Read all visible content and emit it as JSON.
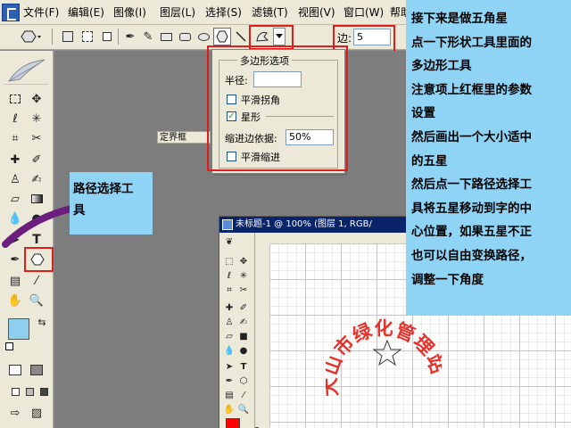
{
  "menu": {
    "items": [
      "文件(F)",
      "编辑(E)",
      "图像(I)",
      "图层(L)",
      "选择(S)",
      "滤镜(T)",
      "视图(V)",
      "窗口(W)",
      "帮助"
    ]
  },
  "options_bar": {
    "sides_label": "边:",
    "sides_value": "5"
  },
  "polygon_options": {
    "title": "多边形选项",
    "radius_label": "半径:",
    "radius_value": "",
    "smooth_corners_label": "平滑拐角",
    "smooth_corners_checked": false,
    "star_label": "星形",
    "star_checked": true,
    "indent_label": "缩进边依据:",
    "indent_value": "50%",
    "smooth_indents_label": "平滑缩进",
    "smooth_indents_checked": false
  },
  "callout": {
    "lines": [
      "路径选择工",
      "具"
    ]
  },
  "instructions": {
    "lines": [
      "接下来是做五角星",
      "点一下形状工具里面的",
      "多边形工具",
      "注意项上红框里的参数",
      "设置",
      "然后画出一个大小适中",
      "的五星",
      "然后点一下路径选择工",
      "具将五星移动到字的中",
      "心位置，如果五星不正",
      "也可以自由变换路径，",
      "调整一下角度"
    ]
  },
  "document": {
    "title": "未标题-1 @ 100% (图层 1, RGB/",
    "ruler_text": "定界框",
    "seal_text": "大山市绿化管理站"
  },
  "colors": {
    "highlight": "#e21b1b",
    "instruction_bg": "#8fd3f5",
    "foreground_swatch": "#8ecfef",
    "doc_foreground_swatch": "#ff0000",
    "seal_text": "#e8312a",
    "arrow": "#6a1f7e"
  }
}
